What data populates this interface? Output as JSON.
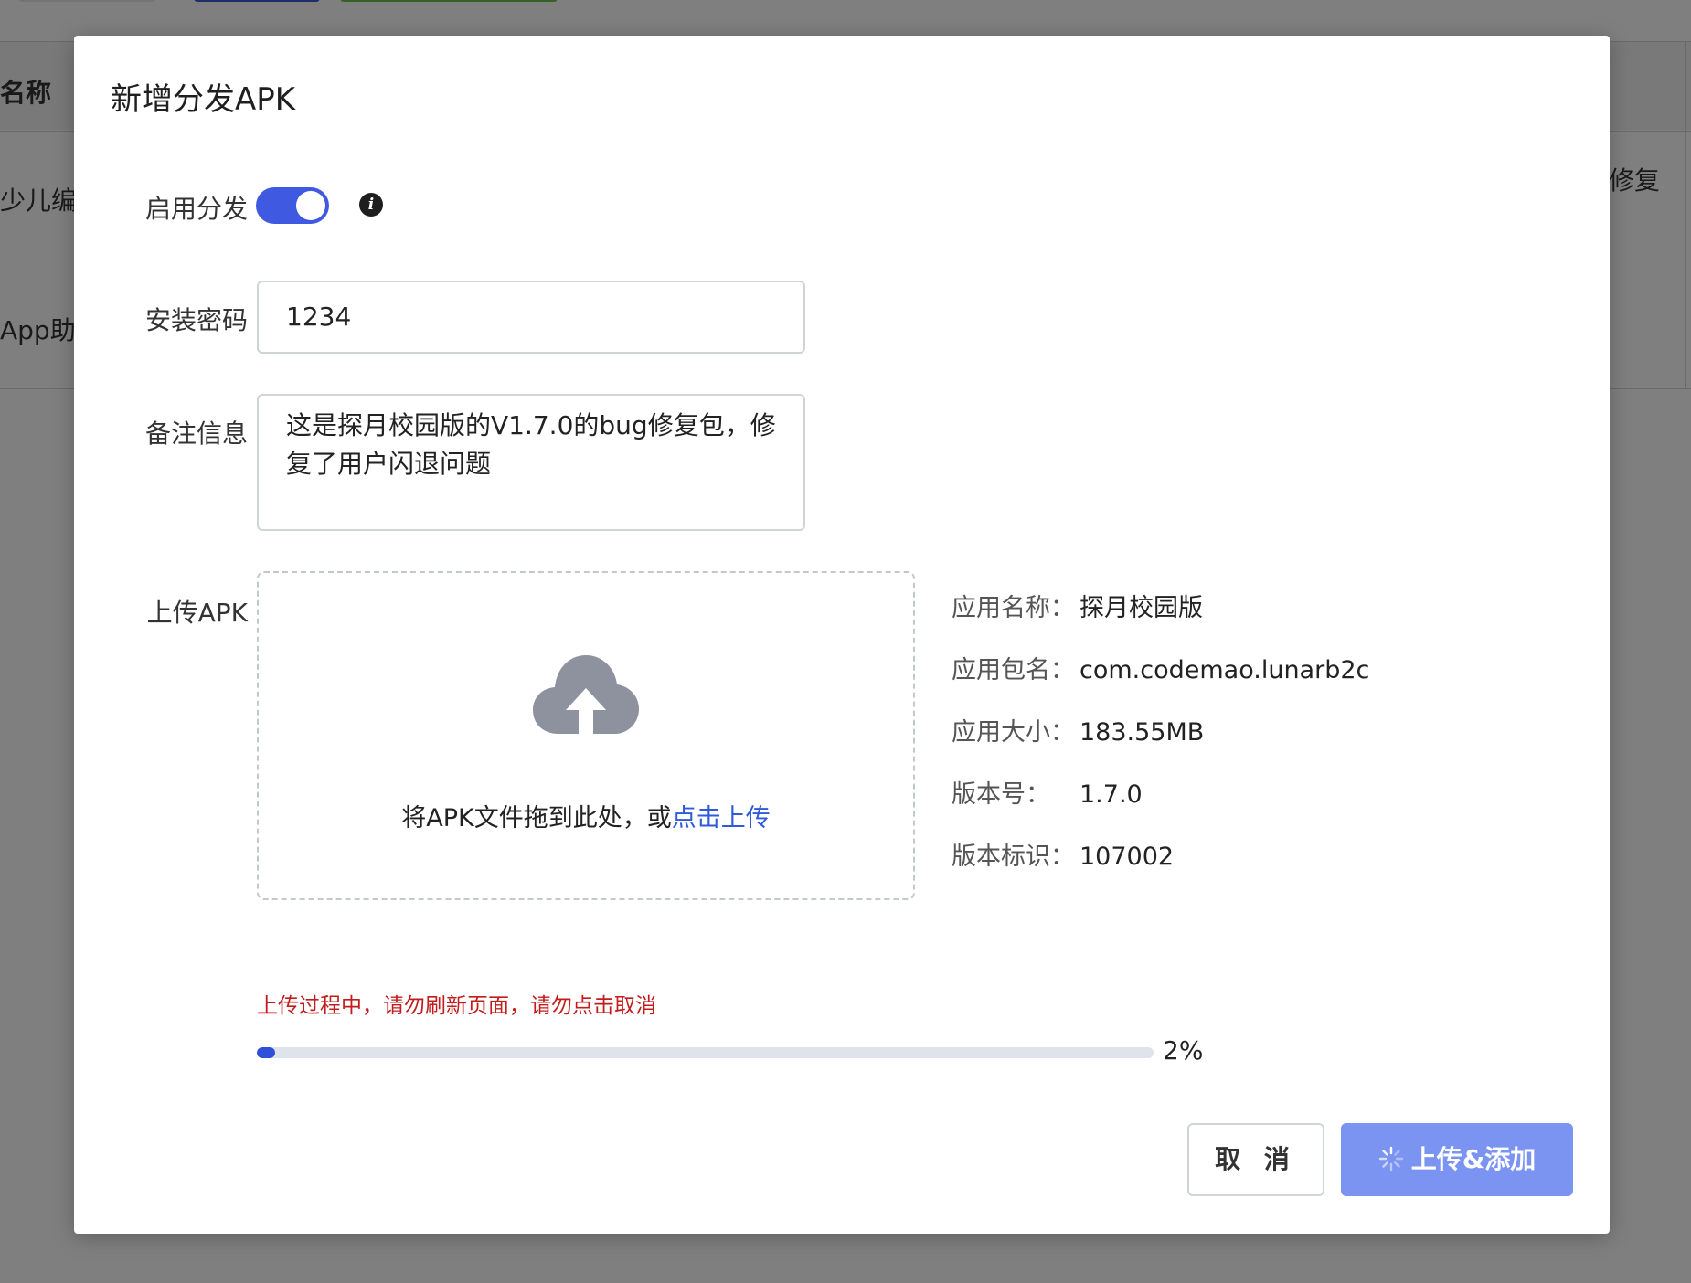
{
  "background": {
    "header_col": "名称",
    "row1_col1": "少儿编",
    "row1_right": "修复",
    "row2_col1": "App助手"
  },
  "dialog": {
    "title": "新增分发APK",
    "enable_label": "启用分发",
    "enable_on": true,
    "password_label": "安装密码",
    "password_value": "1234",
    "remark_label": "备注信息",
    "remark_value": "这是探月校园版的V1.7.0的bug修复包，修复了用户闪退问题",
    "upload_label": "上传APK",
    "dropzone_text": "将APK文件拖到此处，或",
    "dropzone_link": "点击上传",
    "app_info": [
      {
        "key": "应用名称：",
        "value": "探月校园版"
      },
      {
        "key": "应用包名：",
        "value": "com.codemao.lunarb2c"
      },
      {
        "key": "应用大小：",
        "value": "183.55MB"
      },
      {
        "key": "版本号：",
        "value": "1.7.0"
      },
      {
        "key": "版本标识：",
        "value": "107002"
      }
    ],
    "warning": "上传过程中，请勿刷新页面，请勿点击取消",
    "progress_percent": 2,
    "progress_text": "2%",
    "cancel_label": "取 消",
    "submit_label": "上传&添加"
  },
  "colors": {
    "accent": "#3f5ae0",
    "link": "#2f5ad9",
    "warning": "#c21c1c",
    "submit_disabled": "#7b94f2"
  },
  "icons": [
    "info-icon",
    "cloud-upload-icon",
    "loading-spinner-icon"
  ]
}
